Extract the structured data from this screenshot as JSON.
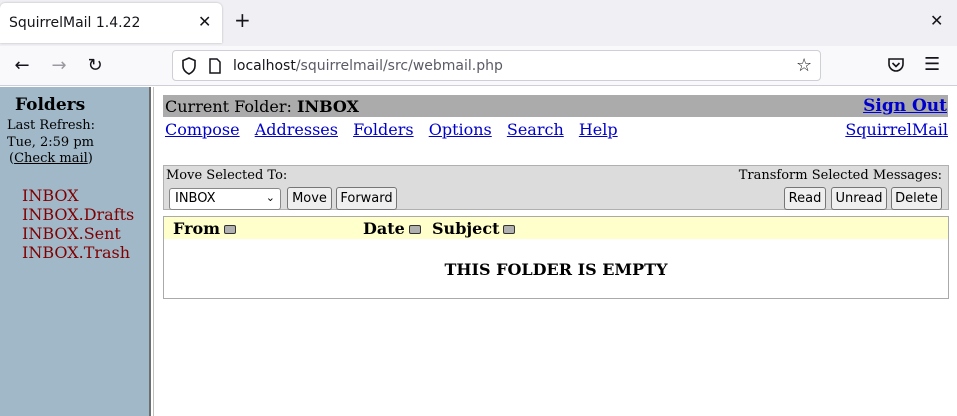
{
  "browser": {
    "tab_title": "SquirrelMail 1.4.22",
    "url_host": "localhost",
    "url_path": "/squirrelmail/src/webmail.php"
  },
  "left": {
    "title": "Folders",
    "last_refresh_label": "Last Refresh:",
    "last_refresh_time": "Tue, 2:59 pm",
    "check_mail_open": "(",
    "check_mail": "Check mail",
    "check_mail_close": ")",
    "folders": [
      "INBOX",
      "INBOX.Drafts",
      "INBOX.Sent",
      "INBOX.Trash"
    ]
  },
  "header": {
    "current_folder_label": "Current Folder: ",
    "current_folder": "INBOX",
    "sign_out": "Sign Out",
    "links": [
      "Compose",
      "Addresses",
      "Folders",
      "Options",
      "Search",
      "Help"
    ],
    "brand_link": "SquirrelMail"
  },
  "move": {
    "label": "Move Selected To:",
    "selected_folder": "INBOX",
    "move_button": "Move",
    "forward_button": "Forward",
    "transform_label": "Transform Selected Messages:",
    "read_button": "Read",
    "unread_button": "Unread",
    "delete_button": "Delete"
  },
  "messages": {
    "columns": [
      "From",
      "Date",
      "Subject"
    ],
    "empty_text": "THIS FOLDER IS EMPTY"
  },
  "colors": {
    "left_pane": "#a0b8c8",
    "folder_link": "#800000",
    "link": "#0000cc",
    "header_bar": "#ababab",
    "table_header": "#ffffcc"
  }
}
